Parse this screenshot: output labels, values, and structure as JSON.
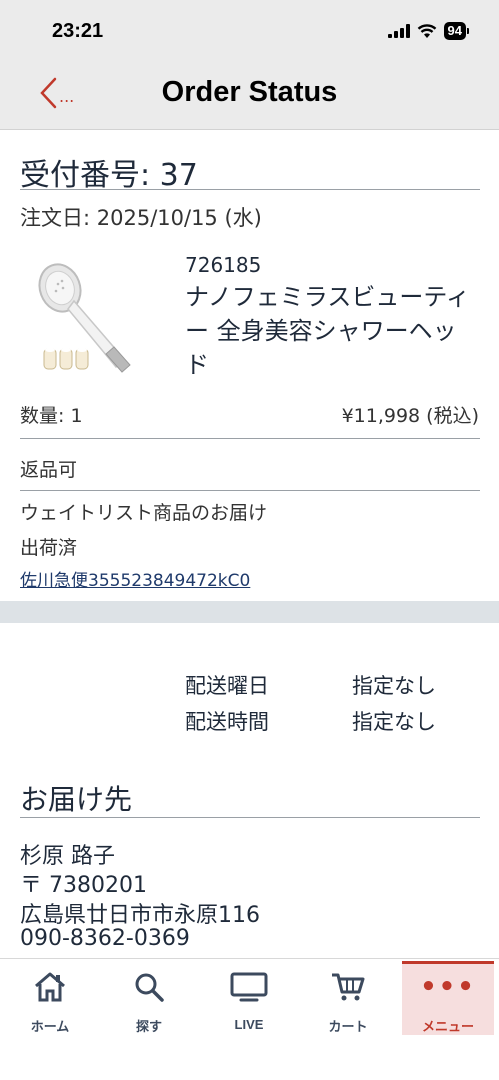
{
  "status_bar": {
    "time": "23:21",
    "battery": "94"
  },
  "nav": {
    "back_label": "...",
    "title": "Order Status"
  },
  "order": {
    "number_label": "受付番号: 37",
    "date_label": "注文日: 2025/10/15 (水)",
    "item": {
      "sku": "726185",
      "name": "ナノフェミラスビューティー 全身美容シャワーヘッド",
      "quantity": "数量: 1",
      "price": "¥11,998 (税込)",
      "image_icon": "shower-head-product-image"
    },
    "returnable": "返品可",
    "waitlist": "ウェイトリスト商品のお届け",
    "shipping_status": "出荷済",
    "tracking": "佐川急便355523849472kC0"
  },
  "delivery": {
    "day_label": "配送曜日",
    "day_value": "指定なし",
    "time_label": "配送時間",
    "time_value": "指定なし"
  },
  "ship_to": {
    "heading": "お届け先",
    "name": "杉原 路子",
    "postal": "〒 7380201",
    "address": "広島県廿日市市永原116",
    "phone": "090-8362-0369"
  },
  "tabs": [
    {
      "label": "ホーム",
      "icon": "home-icon"
    },
    {
      "label": "探す",
      "icon": "search-icon"
    },
    {
      "label": "LIVE",
      "icon": "tv-icon"
    },
    {
      "label": "カート",
      "icon": "cart-icon"
    },
    {
      "label": "メニュー",
      "icon": "more-icon",
      "active": true
    }
  ],
  "colors": {
    "accent": "#c0392b",
    "text": "#1f2a3a",
    "bar_bg": "#ebebeb"
  }
}
